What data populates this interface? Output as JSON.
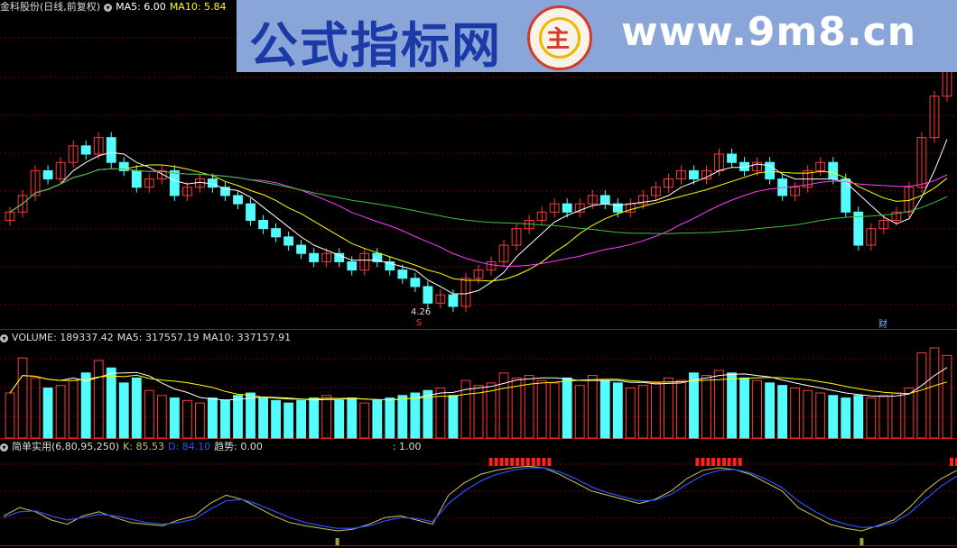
{
  "price_panel": {
    "stock_name": "金科股份(日线,前复权)",
    "ma5_label": "MA5: 6.00",
    "ma10_label": "MA10: 5.84",
    "low_label": "4.26",
    "marker_s": "S",
    "marker_cai": "财"
  },
  "volume_panel": {
    "label": "VOLUME: 189337.42",
    "ma5_label": "MA5: 317557.19",
    "ma10_label": "MA10: 337157.91"
  },
  "indicator_panel": {
    "name": "简单实用(6,80,95,250)",
    "k_label": "K: 85.53",
    "d_label": "D: 84.10",
    "trend_label": "趋势: 0.00",
    "extra_label": ": 1.00"
  },
  "banner": {
    "title": "公式指标网",
    "url": "www.9m8.cn",
    "logo_glyph": "主"
  },
  "colors": {
    "up": "#ff3b3b",
    "down": "#54fcfc",
    "ma5": "#ffffff",
    "ma10": "#ffff00",
    "ma_mid": "#ff40ff",
    "ma_long": "#40c040",
    "k_line": "#c8c850",
    "d_line": "#3050ff",
    "grid": "#7a0000"
  },
  "chart_data": {
    "type": "candlestick",
    "price_closes": [
      5.4,
      5.6,
      5.9,
      5.8,
      6.0,
      6.2,
      6.1,
      6.3,
      6.0,
      5.9,
      5.7,
      5.8,
      5.9,
      5.6,
      5.7,
      5.8,
      5.7,
      5.6,
      5.5,
      5.3,
      5.2,
      5.1,
      5.0,
      4.9,
      4.8,
      4.9,
      4.8,
      4.7,
      4.9,
      4.8,
      4.7,
      4.6,
      4.5,
      4.3,
      4.4,
      4.26,
      4.6,
      4.7,
      4.8,
      5.0,
      5.2,
      5.3,
      5.4,
      5.5,
      5.4,
      5.5,
      5.6,
      5.5,
      5.4,
      5.5,
      5.6,
      5.7,
      5.8,
      5.9,
      5.8,
      5.9,
      6.1,
      6.0,
      5.9,
      6.0,
      5.8,
      5.6,
      5.7,
      5.9,
      6.0,
      5.8,
      5.4,
      5.0,
      5.2,
      5.3,
      5.4,
      5.7,
      6.3,
      6.8,
      7.2
    ],
    "volumes": [
      180,
      320,
      240,
      200,
      210,
      230,
      260,
      310,
      280,
      220,
      240,
      190,
      170,
      160,
      150,
      140,
      160,
      150,
      170,
      180,
      160,
      150,
      140,
      150,
      160,
      170,
      150,
      160,
      140,
      150,
      160,
      170,
      180,
      190,
      200,
      170,
      230,
      210,
      220,
      260,
      240,
      250,
      230,
      220,
      240,
      210,
      250,
      230,
      220,
      200,
      210,
      220,
      240,
      230,
      260,
      250,
      270,
      260,
      240,
      230,
      220,
      210,
      200,
      190,
      180,
      170,
      160,
      170,
      160,
      170,
      180,
      200,
      340,
      360,
      330
    ],
    "k_values": [
      30,
      40,
      35,
      25,
      20,
      30,
      35,
      28,
      22,
      20,
      18,
      25,
      30,
      45,
      55,
      50,
      40,
      30,
      22,
      18,
      15,
      12,
      14,
      20,
      28,
      30,
      25,
      20,
      55,
      70,
      80,
      85,
      88,
      90,
      88,
      80,
      70,
      60,
      55,
      50,
      45,
      50,
      60,
      75,
      85,
      88,
      86,
      80,
      70,
      60,
      40,
      30,
      20,
      15,
      12,
      18,
      25,
      40,
      60,
      75,
      85
    ],
    "d_values": [
      28,
      35,
      36,
      30,
      25,
      28,
      32,
      30,
      26,
      22,
      20,
      22,
      26,
      38,
      48,
      50,
      44,
      36,
      28,
      22,
      18,
      15,
      15,
      18,
      24,
      28,
      27,
      23,
      45,
      60,
      72,
      80,
      85,
      88,
      88,
      83,
      75,
      65,
      58,
      53,
      48,
      49,
      56,
      68,
      79,
      85,
      86,
      82,
      74,
      64,
      48,
      36,
      26,
      20,
      16,
      17,
      22,
      33,
      50,
      66,
      78
    ],
    "ylim_price": [
      4.26,
      7.2
    ]
  }
}
